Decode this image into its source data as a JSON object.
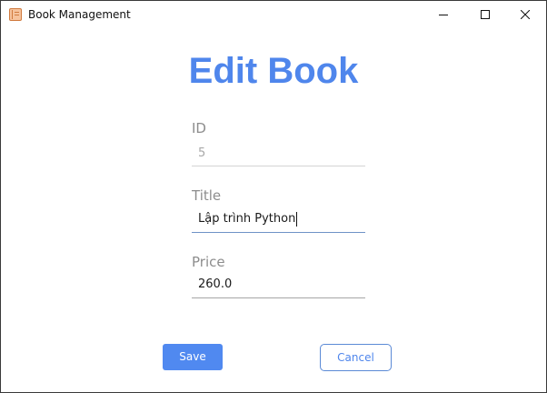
{
  "window": {
    "title": "Book Management",
    "app_icon": "book-icon",
    "controls": [
      "minimize-icon",
      "maximize-icon",
      "close-icon"
    ]
  },
  "form": {
    "heading": "Edit Book",
    "fields": {
      "id": {
        "label": "ID",
        "value": "5",
        "editable": false
      },
      "title": {
        "label": "Title",
        "value": "Lập trình Python",
        "focused": true
      },
      "price": {
        "label": "Price",
        "value": "260.0"
      }
    },
    "save_label": "Save",
    "cancel_label": "Cancel"
  },
  "colors": {
    "accent": "#4f86ec",
    "save_button_bg": "#5089f0",
    "label": "#8d8d8d",
    "window_border": "#3a3a3a"
  }
}
